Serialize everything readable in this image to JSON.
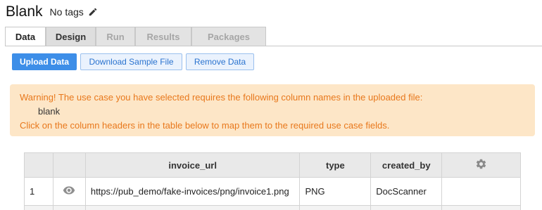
{
  "header": {
    "title": "Blank",
    "tags_label": "No tags",
    "edit_icon": "pencil-icon"
  },
  "tabs": [
    {
      "label": "Data",
      "state": "active"
    },
    {
      "label": "Design",
      "state": "enabled"
    },
    {
      "label": "Run",
      "state": "disabled"
    },
    {
      "label": "Results",
      "state": "disabled"
    },
    {
      "label": "Packages",
      "state": "disabled"
    }
  ],
  "actions": {
    "upload_label": "Upload Data",
    "download_label": "Download Sample File",
    "remove_label": "Remove Data"
  },
  "warning": {
    "line1": "Warning! The use case you have selected requires the following column names in the uploaded file:",
    "column_name": "blank",
    "line2": "Click on the column headers in the table below to map them to the required use case fields."
  },
  "table": {
    "headers": [
      "",
      "",
      "invoice_url",
      "type",
      "created_by",
      ""
    ],
    "settings_icon": "gear-icon",
    "rows": [
      {
        "index": "1",
        "view_icon": "eye-icon",
        "invoice_url": "https://pub_demo/fake-invoices/png/invoice1.png",
        "type": "PNG",
        "created_by": "DocScanner",
        "extra": ""
      }
    ]
  },
  "colors": {
    "primary": "#3d8ee8",
    "warning_bg": "#fde6c7",
    "warning_text": "#e8781c",
    "header_bg": "#e9e9e9"
  }
}
